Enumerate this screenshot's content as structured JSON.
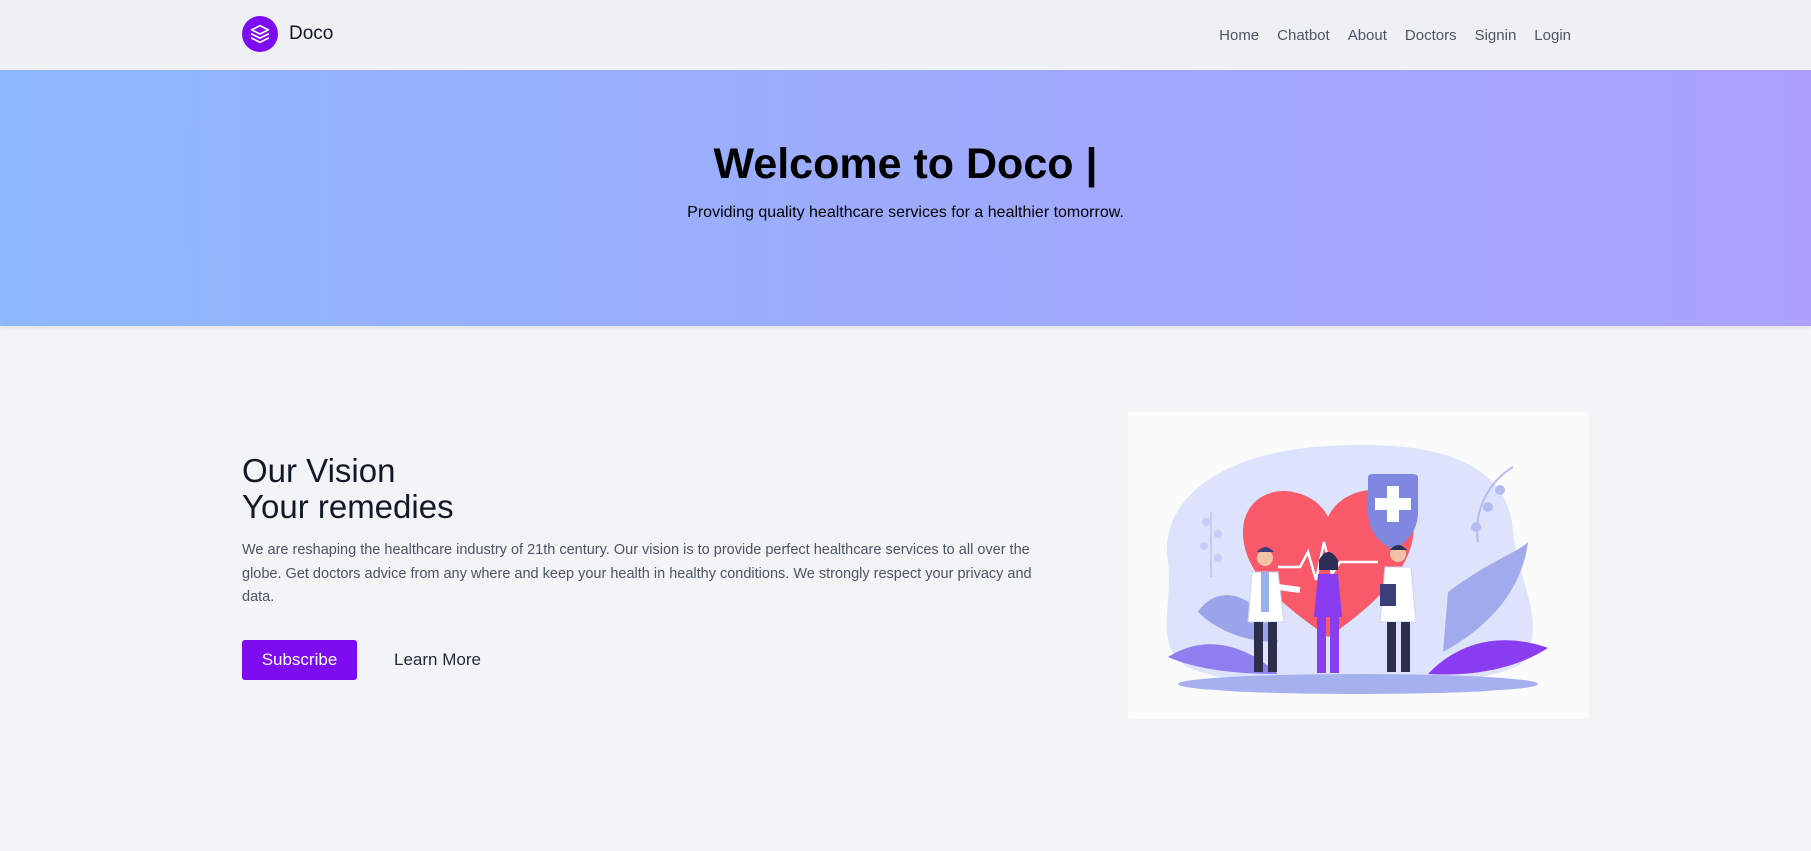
{
  "brand": {
    "name": "Doco",
    "logo_icon": "layers-icon",
    "accent": "#7e0cf0"
  },
  "nav": {
    "items": [
      {
        "label": "Home"
      },
      {
        "label": "Chatbot"
      },
      {
        "label": "About"
      },
      {
        "label": "Doctors"
      },
      {
        "label": "Signin"
      },
      {
        "label": "Login"
      }
    ]
  },
  "hero": {
    "title": "Welcome to Doco |",
    "subtitle": "Providing quality healthcare services for a healthier tomorrow.",
    "gradient": [
      "#8eb8fd",
      "#aba1fc"
    ]
  },
  "vision": {
    "title_line1": "Our Vision",
    "title_line2": "Your remedies",
    "text": "We are reshaping the healthcare industry of 21th century. Our vision is to provide perfect healthcare services to all over the globe. Get doctors advice from any where and keep your health in healthy conditions. We strongly respect your privacy and data.",
    "subscribe_label": "Subscribe",
    "learn_more_label": "Learn More"
  },
  "illustration": {
    "icon": "healthcare-team-illustration"
  }
}
